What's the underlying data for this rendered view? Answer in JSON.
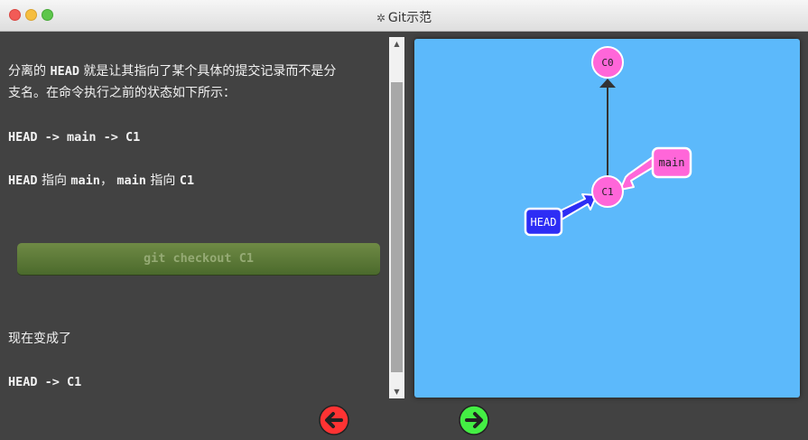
{
  "window": {
    "title": "Git示范"
  },
  "lesson": {
    "paragraph1": "分离的 HEAD 就是让其指向了某个具体的提交记录而不是分支名。在命令执行之前的状态如下所示：",
    "p1_line1_pre": "分离的 ",
    "p1_head": "HEAD",
    "p1_line1_post": " 就是让其指向了某个具体的提交记录而不是分",
    "p1_line2": "支名。在命令执行之前的状态如下所示：",
    "state_before": "HEAD -> main -> C1",
    "description_head": "HEAD",
    "description_text1": " 指向 ",
    "description_main1": "main",
    "description_text2": "， ",
    "description_main2": "main",
    "description_text3": " 指向 ",
    "description_c1": "C1",
    "command": "git checkout C1",
    "now_text": "现在变成了",
    "state_after": "HEAD -> C1"
  },
  "graph": {
    "commits": [
      {
        "id": "C0",
        "color": "#ff66d9"
      },
      {
        "id": "C1",
        "color": "#ff66d9"
      }
    ],
    "branches": [
      {
        "name": "main",
        "color": "#ff66d9",
        "target": "C1"
      }
    ],
    "head": {
      "label": "HEAD",
      "color": "#2d2df5",
      "target": "C1"
    }
  },
  "nav": {
    "back_color": "#ff3333",
    "forward_color": "#44ee44",
    "back_icon": "arrow-left-icon",
    "forward_icon": "arrow-right-icon"
  }
}
